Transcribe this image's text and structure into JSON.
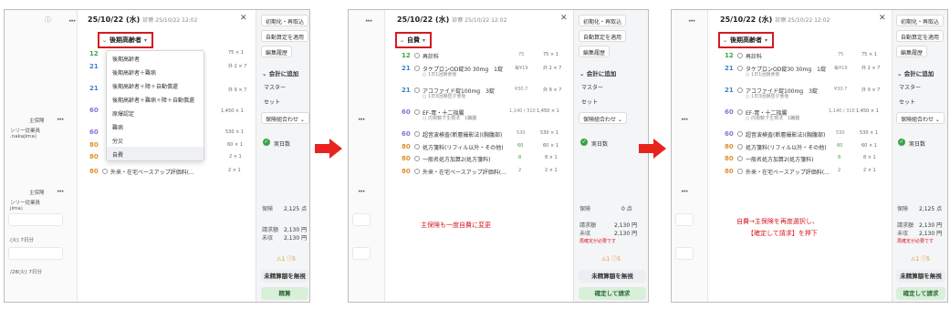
{
  "panel1": {
    "date": "25/10/22 (水)",
    "sub": "診察 25/10/22 12:02",
    "selected_insurance": "後期高齢者",
    "dropdown_options": [
      "後期高齢者",
      "後期高齢者＋難病",
      "後期高齢者＋障＋自動償還",
      "後期高齢者＋難病＋障＋自動償還",
      "原爆認定",
      "難病",
      "労災",
      "自費"
    ],
    "left_role": "主保険",
    "left_line1": "ンリー従業員",
    "left_line2": ".nakajima)",
    "left_role2": "主保険",
    "left_line3": "ンリー従業員",
    "left_line4": "jima)",
    "left_days1": "(火) 7日分",
    "left_days2": "/28(火) 7日分",
    "row_nums": [
      "12",
      "21",
      "21",
      "60",
      "60",
      "80",
      "80"
    ],
    "row_qty": [
      "75 × 1",
      "外 2 × 7",
      "外 9 × 7",
      "1,450 × 1",
      "530 × 1",
      "60 × 1",
      "2 × 1"
    ],
    "last_row": "外来・在宅ベースアップ評価料(...",
    "total_label": "保険",
    "total_val": "2,125 点",
    "billed_label": "請求額",
    "billed_val": "2,130 円",
    "unpaid_label": "未収",
    "unpaid_val": "2,130 円",
    "alerts": "⚠1 ⓘ5",
    "btn_unpaid": "未精算額を無視",
    "btn_settle": "精算",
    "right_buttons": [
      "初期化・再取込",
      "自動算定を適用",
      "編集履歴"
    ],
    "add_section": "会計に追加",
    "master": "マスター",
    "set": "セット",
    "combo": "保険組合わせ",
    "actual_days": "実日数"
  },
  "panel2": {
    "date": "25/10/22 (水)",
    "sub": "診察 25/10/22 12:02",
    "selected_insurance": "自費",
    "rows": [
      {
        "num": "12",
        "name": "再診料",
        "pts": "75",
        "qty": "75 × 1"
      },
      {
        "num": "21",
        "name": "タケプロンOD錠30 30mg　1錠",
        "sub": "1日1回朝食後",
        "pts": "毎¥19",
        "qty": "外 2 × 7"
      },
      {
        "num": "21",
        "name": "アコファイド錠100mg　3錠",
        "sub": "1日3回朝昼夕食後",
        "pts": "¥30.7",
        "qty": "外 9 × 7"
      },
      {
        "num": "60",
        "name": "EF-胃・十二指腸",
        "sub": "内視鏡下生検法　1臓器",
        "pts": "1,140 / 310",
        "qty": "1,450 × 1"
      },
      {
        "num": "60",
        "name": "超音波検査(断層撮影法)(胸腹部)",
        "pts": "530",
        "qty": "530 × 1"
      },
      {
        "num": "80",
        "name": "処方箋料(リフィル以外・その他)",
        "pts": "60",
        "qty": "60 × 1"
      },
      {
        "num": "80",
        "name": "一般名処方加算2(処方箋料)",
        "pts": "8",
        "qty": "8 × 1"
      },
      {
        "num": "80",
        "name": "外来・在宅ベースアップ評価料(...",
        "pts": "2",
        "qty": "2 × 1"
      }
    ],
    "note": "主保険も一度自費に変更",
    "total_label": "保険",
    "total_val": "0 点",
    "billed_label": "請求額",
    "billed_val": "2,130 円",
    "unpaid_label": "未収",
    "unpaid_val": "2,130 円",
    "warn": "再確定が必要です",
    "alerts": "⚠1 ⓘ5",
    "btn_unpaid": "未精算額を無視",
    "btn_confirm": "確定して請求",
    "right_buttons": [
      "初期化・再取込",
      "自動算定を適用",
      "編集履歴"
    ],
    "add_section": "会計に追加",
    "master": "マスター",
    "set": "セット",
    "combo": "保険組合わせ",
    "actual_days": "実日数"
  },
  "panel3": {
    "date": "25/10/22 (水)",
    "sub": "診察 25/10/22 12:02",
    "selected_insurance": "後期高齢者",
    "rows": [
      {
        "num": "12",
        "name": "再診料",
        "pts": "75",
        "qty": "75 × 1"
      },
      {
        "num": "21",
        "name": "タケプロンOD錠30 30mg　1錠",
        "sub": "1日1回朝食後",
        "pts": "毎¥19",
        "qty": "外 2 × 7"
      },
      {
        "num": "21",
        "name": "アコファイド錠100mg　3錠",
        "sub": "1日3回朝昼夕食後",
        "pts": "¥30.7",
        "qty": "外 9 × 7"
      },
      {
        "num": "60",
        "name": "EF-胃・十二指腸",
        "sub": "内視鏡下生検法　1臓器",
        "pts": "1,140 / 310",
        "qty": "1,450 × 1"
      },
      {
        "num": "60",
        "name": "超音波検査(断層撮影法)(胸腹部)",
        "pts": "530",
        "qty": "530 × 1"
      },
      {
        "num": "80",
        "name": "処方箋料(リフィル以外・その他)",
        "pts": "60",
        "qty": "60 × 1"
      },
      {
        "num": "80",
        "name": "一般名処方加算2(処方箋料)",
        "pts": "8",
        "qty": "8 × 1"
      },
      {
        "num": "80",
        "name": "外来・在宅ベースアップ評価料(...",
        "pts": "2",
        "qty": "2 × 1"
      }
    ],
    "note_line1": "自費→主保険を再度選択し、",
    "note_line2": "【確定して請求】を押下",
    "total_label": "保険",
    "total_val": "2,125 点",
    "billed_label": "請求額",
    "billed_val": "2,130 円",
    "unpaid_label": "未収",
    "unpaid_val": "2,130 円",
    "warn": "再確定が必要です",
    "alerts": "⚠1 ⓘ5",
    "btn_unpaid": "未精算額を無視",
    "btn_confirm": "確定して請求",
    "right_buttons": [
      "初期化・再取込",
      "自動算定を適用",
      "編集履歴"
    ],
    "add_section": "会計に追加",
    "master": "マスター",
    "set": "セット",
    "combo": "保険組合わせ",
    "actual_days": "実日数"
  },
  "colors": {
    "highlight_red": "#d71920",
    "arrow_red": "#e8231e",
    "code_green": "#3aa34a",
    "code_blue": "#3b82c4",
    "code_purple": "#8f6ed5",
    "code_orange": "#e0902c"
  }
}
